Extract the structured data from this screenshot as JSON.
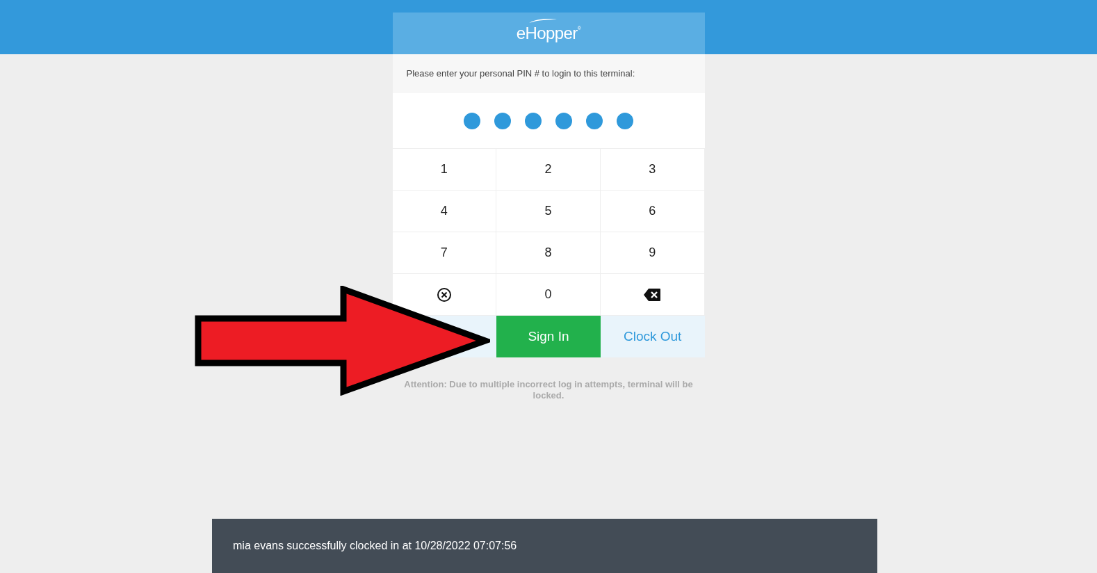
{
  "logo": {
    "text": "eHopper",
    "mark": "®"
  },
  "prompt": "Please enter your personal PIN # to login to this terminal:",
  "pin_dots": [
    {
      "filled": true
    },
    {
      "filled": true
    },
    {
      "filled": true
    },
    {
      "filled": true
    },
    {
      "filled": true
    },
    {
      "filled": true
    }
  ],
  "keypad": [
    {
      "kind": "digit",
      "label": "1"
    },
    {
      "kind": "digit",
      "label": "2"
    },
    {
      "kind": "digit",
      "label": "3"
    },
    {
      "kind": "digit",
      "label": "4"
    },
    {
      "kind": "digit",
      "label": "5"
    },
    {
      "kind": "digit",
      "label": "6"
    },
    {
      "kind": "digit",
      "label": "7"
    },
    {
      "kind": "digit",
      "label": "8"
    },
    {
      "kind": "digit",
      "label": "9"
    },
    {
      "kind": "clear"
    },
    {
      "kind": "digit",
      "label": "0"
    },
    {
      "kind": "backspace"
    }
  ],
  "actions": [
    {
      "kind": "blank"
    },
    {
      "kind": "primary",
      "label": "Sign In"
    },
    {
      "kind": "secondary",
      "label": "Clock Out"
    }
  ],
  "attention": "Attention: Due to multiple incorrect log in attempts, terminal will be locked.",
  "annotation": {
    "kind": "arrow"
  },
  "toast": "mia evans successfully clocked in at 10/28/2022 07:07:56"
}
